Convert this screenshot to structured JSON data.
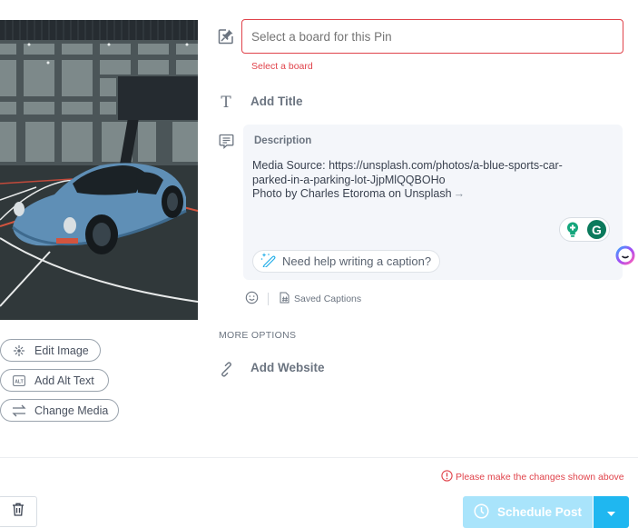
{
  "media": {
    "alt": "A blue sports car parked in a parking lot",
    "actions": {
      "edit_image": "Edit Image",
      "add_alt_text": "Add Alt Text",
      "change_media": "Change Media"
    },
    "icons": {
      "edit_image": "magic-wand-icon",
      "add_alt_text": "alt-text-icon",
      "change_media": "swap-arrows-icon"
    }
  },
  "board": {
    "placeholder": "Select a board for this Pin",
    "error": "Select a board",
    "icon": "pin-board-icon"
  },
  "title": {
    "placeholder": "Add Title",
    "icon": "text-icon"
  },
  "description": {
    "label": "Description",
    "text": "Media Source: https://unsplash.com/photos/a-blue-sports-car-\nparked-in-a-parking-lot-JjpMlQQBOHo\nPhoto by Charles Etoroma on Unsplash",
    "arrow": "→",
    "icon": "comment-icon",
    "caption_help": "Need help writing a caption?",
    "grammarly_logo": "G"
  },
  "description_tools": {
    "emoji_icon": "emoji-icon",
    "saved_captions": "Saved Captions"
  },
  "more_options": {
    "heading": "MORE OPTIONS",
    "website_placeholder": "Add Website",
    "website_icon": "link-icon"
  },
  "footer": {
    "error": "Please make the changes shown above",
    "schedule_label": "Schedule Post",
    "colors": {
      "error": "#e0434b",
      "schedule_disabled": "#a9e4fb",
      "schedule_dropdown": "#1fb7f0"
    }
  }
}
